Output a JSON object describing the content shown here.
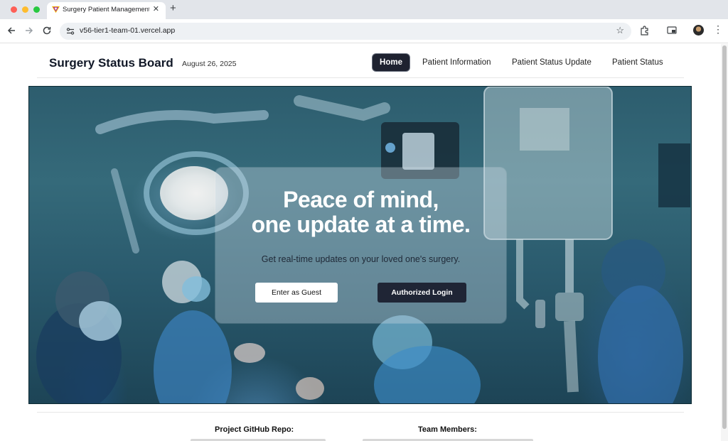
{
  "browser": {
    "tab_title": "Surgery Patient Management",
    "tab_close": "✕",
    "new_tab": "+",
    "url": "v56-tier1-team-01.vercel.app",
    "star": "☆",
    "menu": "⋮",
    "icons": [
      "back-arrow-icon",
      "forward-arrow-icon",
      "reload-icon",
      "site-settings-icon",
      "bookmark-star-icon",
      "extensions-icon",
      "cast-icon",
      "profile-avatar-icon",
      "more-menu-icon"
    ]
  },
  "header": {
    "title": "Surgery Status Board",
    "date": "August 26, 2025",
    "nav": [
      {
        "label": "Home",
        "active": true
      },
      {
        "label": "Patient Information",
        "active": false
      },
      {
        "label": "Patient Status Update",
        "active": false
      },
      {
        "label": "Patient Status",
        "active": false
      }
    ]
  },
  "hero": {
    "headline_line1": "Peace of mind,",
    "headline_line2": "one update at a time.",
    "subtext": "Get real-time updates on your loved one's surgery.",
    "guest_button": "Enter as Guest",
    "login_button": "Authorized Login"
  },
  "footer": {
    "repo_heading": "Project GitHub Repo:",
    "team_heading": "Team Members:"
  },
  "colors": {
    "nav_active_bg": "#1e2230",
    "login_button_bg": "#1f2535",
    "hero_tint": "#2d5d6e"
  }
}
